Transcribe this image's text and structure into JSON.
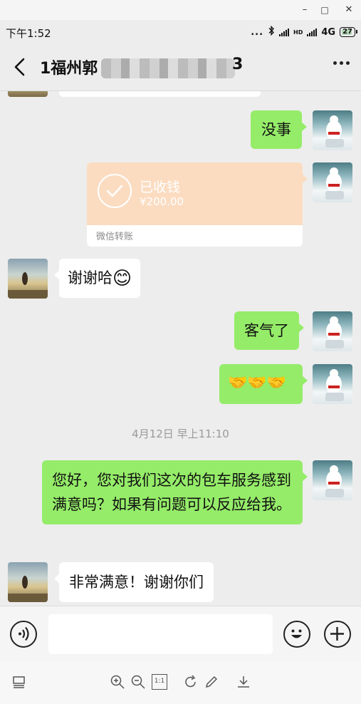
{
  "window": {
    "minimize_label": "–",
    "maximize_label": "□",
    "close_label": "✕"
  },
  "status_bar": {
    "time": "下午1:52",
    "dots": "...",
    "bluetooth_icon": "bluetooth-icon",
    "network": "4G",
    "hd_label": "HD",
    "battery": "27"
  },
  "header": {
    "title_prefix": "1福州郭",
    "title_suffix": "3",
    "back_icon": "back-arrow-icon",
    "more_icon": "more-icon"
  },
  "messages": [
    {
      "sender": "me",
      "type": "text",
      "text": "没事"
    },
    {
      "sender": "me",
      "type": "transfer",
      "status": "已收钱",
      "amount": "¥200.00",
      "footer": "微信转账"
    },
    {
      "sender": "other",
      "type": "text",
      "text": "谢谢哈",
      "emoji": "😊"
    },
    {
      "sender": "me",
      "type": "text",
      "text": "客气了"
    },
    {
      "sender": "me",
      "type": "emoji",
      "text": "🤝🤝🤝"
    },
    {
      "sender": "system",
      "type": "time",
      "text": "4月12日 早上11:10"
    },
    {
      "sender": "me",
      "type": "text",
      "text": "您好，您对我们这次的包车服务感到满意吗？如果有问题可以反应给我。"
    },
    {
      "sender": "other",
      "type": "text",
      "text": "非常满意！谢谢你们"
    }
  ],
  "input_bar": {
    "voice_icon": "voice-icon",
    "emoji_icon": "emoji-icon",
    "plus_icon": "plus-icon",
    "input_value": ""
  },
  "toolbar": {
    "fit_label": "1:1"
  },
  "colors": {
    "bubble_green": "#95ec69",
    "transfer_orange": "#fbdcc1",
    "background": "#ededed"
  }
}
